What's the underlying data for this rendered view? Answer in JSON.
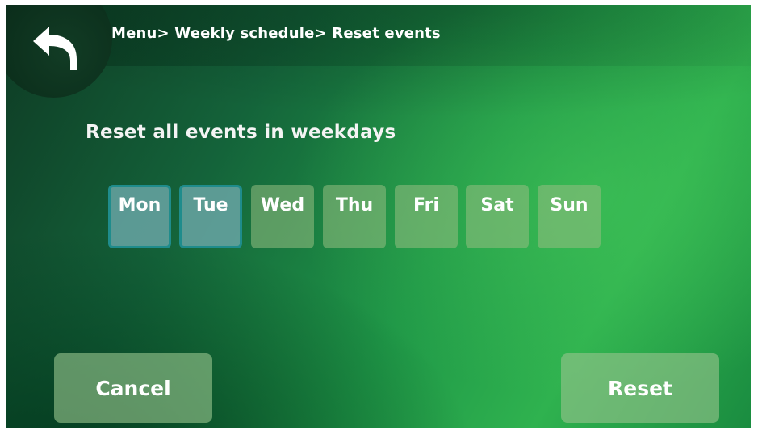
{
  "header": {
    "back_icon": "back-arrow-icon",
    "breadcrumb": "Menu> Weekly schedule> Reset events"
  },
  "main": {
    "title": "Reset all events in weekdays",
    "days": [
      {
        "label": "Mon",
        "selected": true
      },
      {
        "label": "Tue",
        "selected": true
      },
      {
        "label": "Wed",
        "selected": false
      },
      {
        "label": "Thu",
        "selected": false
      },
      {
        "label": "Fri",
        "selected": false
      },
      {
        "label": "Sat",
        "selected": false
      },
      {
        "label": "Sun",
        "selected": false
      }
    ]
  },
  "footer": {
    "cancel_label": "Cancel",
    "reset_label": "Reset"
  },
  "colors": {
    "background": "#1f9747",
    "selected_day": "#69a5a5",
    "selected_border": "#1f8c8c",
    "unselected_day": "#96be82"
  }
}
